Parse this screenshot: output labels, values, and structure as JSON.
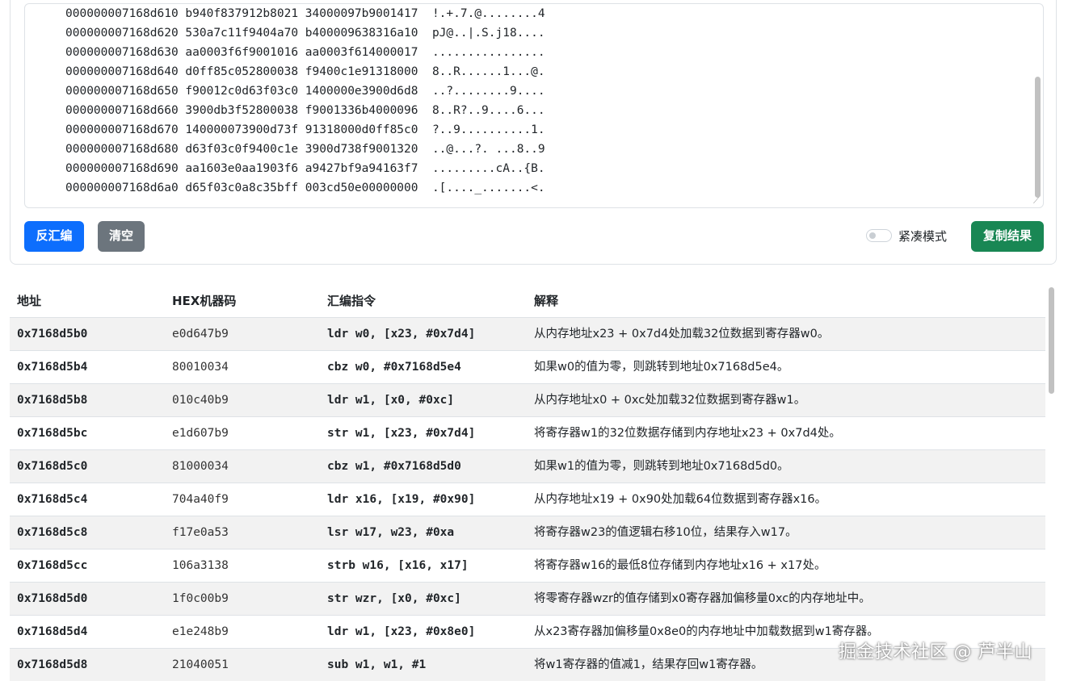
{
  "hex_dump": {
    "partial_line": "                                                                              ",
    "lines": [
      "000000007168d610 b940f837912b8021 34000097b9001417  !.+.7.@........4",
      "000000007168d620 530a7c11f9404a70 b400009638316a10  pJ@..|.S.j18....",
      "000000007168d630 aa0003f6f9001016 aa0003f614000017  ................",
      "000000007168d640 d0ff85c052800038 f9400c1e91318000  8..R......1...@.",
      "000000007168d650 f90012c0d63f03c0 1400000e3900d6d8  ..?........9....",
      "000000007168d660 3900db3f52800038 f9001336b4000096  8..R?..9....6...",
      "000000007168d670 140000073900d73f 91318000d0ff85c0  ?..9..........1.",
      "000000007168d680 d63f03c0f9400c1e 3900d738f9001320  ..@...?. ...8..9",
      "000000007168d690 aa1603e0aa1903f6 a9427bf9a94163f7  .........cA..{B.",
      "000000007168d6a0 d65f03c0a8c35bff 003cd50e00000000  .[...._.......<."
    ]
  },
  "toolbar": {
    "disassemble_label": "反汇编",
    "clear_label": "清空",
    "compact_label": "紧凑模式",
    "compact_on": false,
    "copy_label": "复制结果"
  },
  "table": {
    "headers": [
      "地址",
      "HEX机器码",
      "汇编指令",
      "解释"
    ],
    "rows": [
      {
        "addr": "0x7168d5b0",
        "hex": "e0d647b9",
        "asm": "ldr w0, [x23, #0x7d4]",
        "desc": "从内存地址x23 + 0x7d4处加载32位数据到寄存器w0。"
      },
      {
        "addr": "0x7168d5b4",
        "hex": "80010034",
        "asm": "cbz w0, #0x7168d5e4",
        "desc": "如果w0的值为零，则跳转到地址0x7168d5e4。"
      },
      {
        "addr": "0x7168d5b8",
        "hex": "010c40b9",
        "asm": "ldr w1, [x0, #0xc]",
        "desc": "从内存地址x0 + 0xc处加载32位数据到寄存器w1。"
      },
      {
        "addr": "0x7168d5bc",
        "hex": "e1d607b9",
        "asm": "str w1, [x23, #0x7d4]",
        "desc": "将寄存器w1的32位数据存储到内存地址x23 + 0x7d4处。"
      },
      {
        "addr": "0x7168d5c0",
        "hex": "81000034",
        "asm": "cbz w1, #0x7168d5d0",
        "desc": "如果w1的值为零，则跳转到地址0x7168d5d0。"
      },
      {
        "addr": "0x7168d5c4",
        "hex": "704a40f9",
        "asm": "ldr x16, [x19, #0x90]",
        "desc": "从内存地址x19 + 0x90处加载64位数据到寄存器x16。"
      },
      {
        "addr": "0x7168d5c8",
        "hex": "f17e0a53",
        "asm": "lsr w17, w23, #0xa",
        "desc": "将寄存器w23的值逻辑右移10位，结果存入w17。"
      },
      {
        "addr": "0x7168d5cc",
        "hex": "106a3138",
        "asm": "strb w16, [x16, x17]",
        "desc": "将寄存器w16的最低8位存储到内存地址x16 + x17处。"
      },
      {
        "addr": "0x7168d5d0",
        "hex": "1f0c00b9",
        "asm": "str wzr, [x0, #0xc]",
        "desc": "将零寄存器wzr的值存储到x0寄存器加偏移量0xc的内存地址中。"
      },
      {
        "addr": "0x7168d5d4",
        "hex": "e1e248b9",
        "asm": "ldr w1, [x23, #0x8e0]",
        "desc": "从x23寄存器加偏移量0x8e0的内存地址中加载数据到w1寄存器。"
      },
      {
        "addr": "0x7168d5d8",
        "hex": "21040051",
        "asm": "sub w1, w1, #1",
        "desc": "将w1寄存器的值减1，结果存回w1寄存器。"
      }
    ]
  },
  "watermark": "掘金技术社区 @ 芦半山"
}
